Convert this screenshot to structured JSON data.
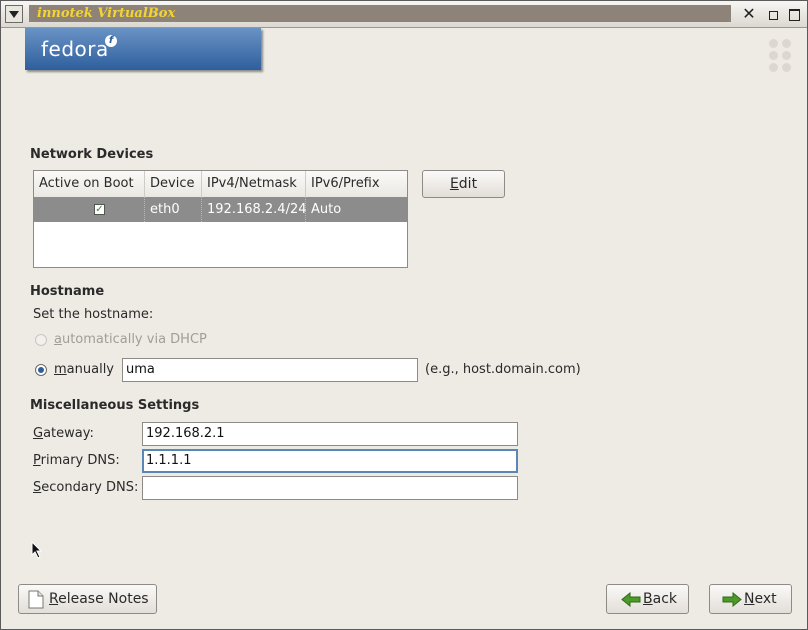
{
  "window": {
    "title": "innotek VirtualBox"
  },
  "branding": {
    "logo_text": "fedora",
    "logo_mark": "f"
  },
  "network_devices": {
    "heading": "Network Devices",
    "columns": [
      "Active on Boot",
      "Device",
      "IPv4/Netmask",
      "IPv6/Prefix"
    ],
    "rows": [
      {
        "active": true,
        "device": "eth0",
        "ipv4": "192.168.2.4/24",
        "ipv6": "Auto"
      }
    ],
    "edit_button": {
      "label_mnemonic": "E",
      "label_rest": "dit"
    }
  },
  "hostname": {
    "heading": "Hostname",
    "instruction": "Set the hostname:",
    "dhcp_option": {
      "mnemonic": "a",
      "rest": "utomatically via DHCP",
      "enabled": false,
      "selected": false
    },
    "manual_option": {
      "mnemonic": "m",
      "rest": "anually",
      "selected": true
    },
    "value": "uma",
    "example": "(e.g., host.domain.com)"
  },
  "misc": {
    "heading": "Miscellaneous Settings",
    "gateway": {
      "mnemonic": "G",
      "rest": "ateway:",
      "value": "192.168.2.1"
    },
    "primary_dns": {
      "mnemonic": "P",
      "rest": "rimary DNS:",
      "value": "1.1.1.1"
    },
    "secondary_dns": {
      "mnemonic": "S",
      "rest": "econdary DNS:",
      "value": ""
    }
  },
  "footer": {
    "release_notes": {
      "mnemonic": "R",
      "rest": "elease Notes"
    },
    "back": {
      "mnemonic": "B",
      "rest": "ack"
    },
    "next": {
      "mnemonic": "N",
      "rest": "ext"
    }
  },
  "icons": {
    "system_menu": "chevron-down-icon",
    "close": "close-icon",
    "minimize": "minimize-icon",
    "maximize": "maximize-icon",
    "release_notes": "document-icon",
    "back": "arrow-left-icon",
    "next": "arrow-right-icon",
    "cursor": "mouse-pointer-icon"
  },
  "colors": {
    "title_text": "#f4d433",
    "banner": "#2e5f9d",
    "selection_row": "#8c8c8c",
    "arrow_green": "#4c9a2a"
  }
}
